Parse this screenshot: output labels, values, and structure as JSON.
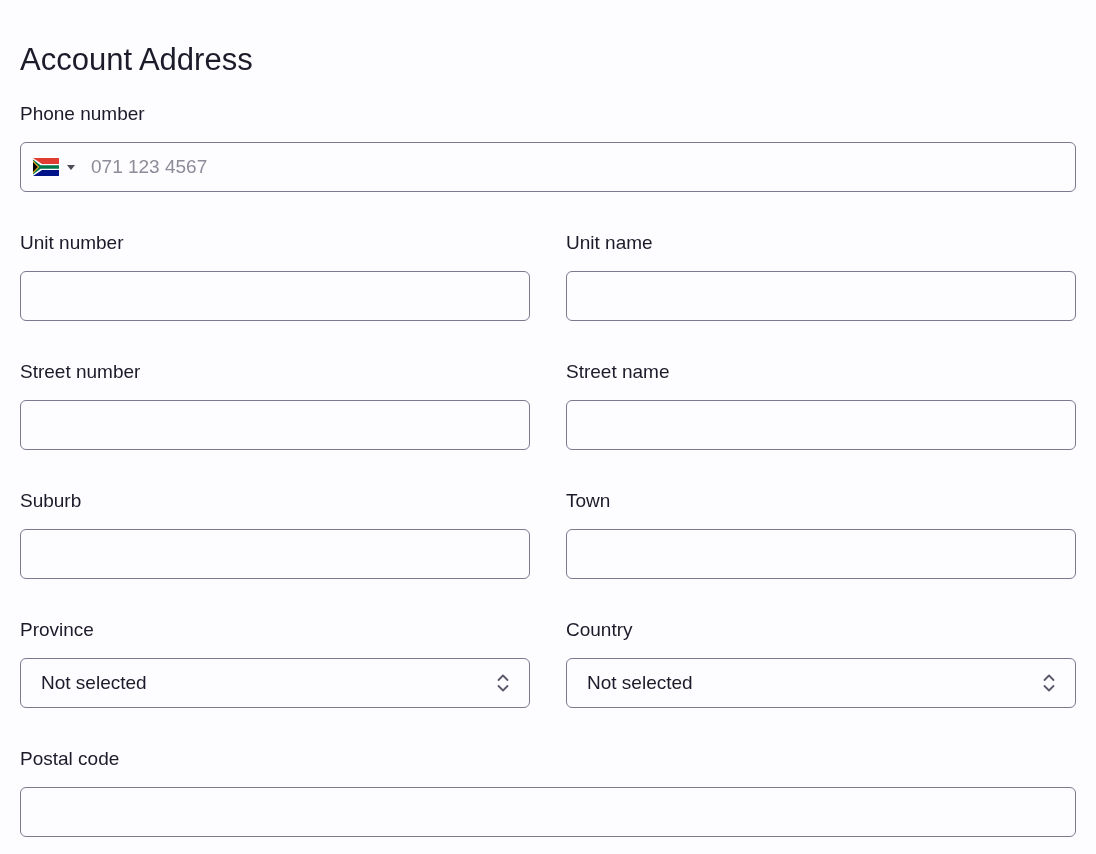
{
  "title": "Account Address",
  "rows": [
    [
      {
        "kind": "phone",
        "label": "Phone number",
        "placeholder": "071 123 4567"
      }
    ],
    [
      {
        "kind": "text",
        "label": "Unit number"
      },
      {
        "kind": "text",
        "label": "Unit name"
      }
    ],
    [
      {
        "kind": "text",
        "label": "Street number"
      },
      {
        "kind": "text",
        "label": "Street name"
      }
    ],
    [
      {
        "kind": "text",
        "label": "Suburb"
      },
      {
        "kind": "text",
        "label": "Town"
      }
    ],
    [
      {
        "kind": "select",
        "label": "Province",
        "value": "Not selected"
      },
      {
        "kind": "select",
        "label": "Country",
        "value": "Not selected"
      }
    ],
    [
      {
        "kind": "text",
        "label": "Postal code"
      }
    ]
  ]
}
